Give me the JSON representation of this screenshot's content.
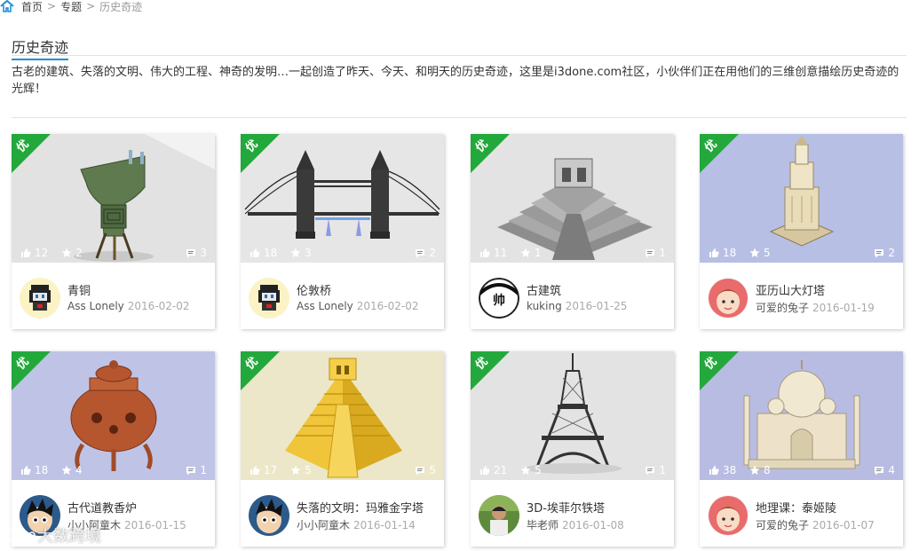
{
  "breadcrumb": {
    "items": [
      "首页",
      "专题",
      "历史奇迹"
    ],
    "separator": ">"
  },
  "section": {
    "title": "历史奇迹",
    "description": "古老的建筑、失落的文明、伟大的工程、神奇的发明…一起创造了昨天、今天、和明天的历史奇迹，这里是i3done.com社区，小伙伴们正在用他们的三维创意描绘历史奇迹的光辉！"
  },
  "badge_label": "优",
  "colors": {
    "accent": "#1e8fd6",
    "badge": "#23a83c"
  },
  "cards": [
    {
      "title": "青铜",
      "author": "Ass Lonely",
      "date": "2016-02-02",
      "likes": "12",
      "favorites": "2",
      "comments": "3",
      "thumb": "bronze-vessel",
      "avatar": "pixel-character"
    },
    {
      "title": "伦敦桥",
      "author": "Ass Lonely",
      "date": "2016-02-02",
      "likes": "18",
      "favorites": "3",
      "comments": "2",
      "thumb": "tower-bridge",
      "avatar": "pixel-character"
    },
    {
      "title": "古建筑",
      "author": "kuking",
      "date": "2016-01-25",
      "likes": "11",
      "favorites": "1",
      "comments": "1",
      "thumb": "stepped-pyramid",
      "avatar": "shuai-face"
    },
    {
      "title": "亚历山大灯塔",
      "author": "可爱的兔子",
      "date": "2016-01-19",
      "likes": "18",
      "favorites": "5",
      "comments": "2",
      "thumb": "lighthouse",
      "avatar": "cartoon-girl"
    },
    {
      "title": "古代道教香炉",
      "author": "小小阿童木",
      "date": "2016-01-15",
      "likes": "18",
      "favorites": "4",
      "comments": "1",
      "thumb": "incense-burner",
      "avatar": "astro-boy"
    },
    {
      "title": "失落的文明：玛雅金字塔",
      "author": "小小阿童木",
      "date": "2016-01-14",
      "likes": "17",
      "favorites": "5",
      "comments": "5",
      "thumb": "maya-pyramid",
      "avatar": "astro-boy"
    },
    {
      "title": "3D-埃菲尔铁塔",
      "author": "毕老师",
      "date": "2016-01-08",
      "likes": "21",
      "favorites": "5",
      "comments": "1",
      "thumb": "eiffel-tower",
      "avatar": "photo-person"
    },
    {
      "title": "地理课：泰姬陵",
      "author": "可爱的兔子",
      "date": "2016-01-07",
      "likes": "38",
      "favorites": "8",
      "comments": "4",
      "thumb": "taj-mahal",
      "avatar": "cartoon-girl"
    }
  ],
  "watermark": "大数跨境"
}
